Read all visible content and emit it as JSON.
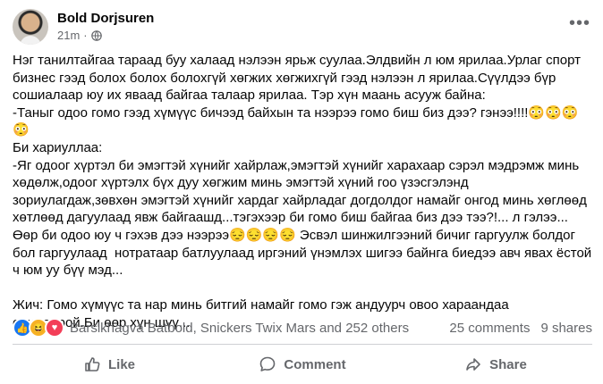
{
  "author": {
    "name": "Bold Dorjsuren",
    "time": "21m",
    "separator": "·"
  },
  "post_text": "Нэг танилтайгаа тараад буу халаад нэлээн ярьж суулаа.Элдвийн л юм ярилаа.Урлаг спорт бизнес гээд болох болох болохгүй хөгжих хөгжихгүй гээд нэлээн л ярилаа.Сүүлдээ бүр сошиалаар юу их яваад байгаа талаар ярилаа. Тэр хүн маань асууж байна:\n-Таныг одоо гомо гээд хүмүүс бичээд байхын та нээрээ гомо биш биз дээ? гэнээ!!!!😳😳😳😳\nБи хариуллаа:\n-Яг одоог хүртэл би эмэгтэй хүнийг хайрлаж,эмэгтэй хүнийг харахаар сэрэл мэдрэмж минь хөдөлж,одоог хүртэлх бүх дуу хөгжим минь эмэгтэй хүний гоо үзэсгэлэнд зориулагдаж,зөвхөн эмэгтэй хүнийг хардаг хайрладаг догдолдог намайг онгод минь хөглөөд хөтлөөд дагуулаад явж байгаашд...тэгэхээр би гомо биш байгаа биз дээ тээ?!... л гэлээ...\nӨөр би одоо юу ч гэхэв дээ нээрээ😔😔😔😔 Эсвэл шинжилгээний бичиг гаргуулж болдог бол гаргуулаад  нотратаар батлуулаад иргэний үнэмлэх шигээ байнга биедээ авч явах ёстой ч юм уу бүү мэд...\n\nЖич: Гомо хүмүүс та нар минь битгий намайг гомо гэж андуурч овоо хараандаа онилоорой.Би өөр хүн шүү...",
  "reactions": {
    "icons": [
      "like-icon",
      "haha-icon",
      "love-icon"
    ],
    "names": "Barslkhagva Batbold, Snickers Twix Mars and 252 others",
    "comments": "25 comments",
    "shares": "9 shares"
  },
  "actions": {
    "like": "Like",
    "comment": "Comment",
    "share": "Share"
  },
  "colors": {
    "secondary_text": "#65676b",
    "like_blue": "#1877f2",
    "divider": "#ced0d4"
  }
}
